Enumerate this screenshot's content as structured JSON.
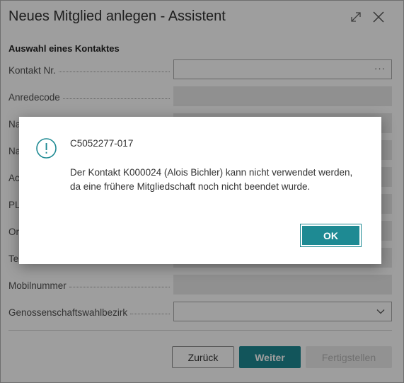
{
  "window": {
    "title": "Neues Mitglied anlegen - Assistent",
    "expand_icon": "expand-icon",
    "close_icon": "close-icon"
  },
  "section": {
    "heading": "Auswahl eines Kontaktes"
  },
  "fields": [
    {
      "label": "Kontakt Nr.",
      "value": "",
      "lookup": "···"
    },
    {
      "label": "Anredecode",
      "value": ""
    },
    {
      "label": "Na",
      "value": ""
    },
    {
      "label": "Na",
      "value": ""
    },
    {
      "label": "Ac",
      "value": ""
    },
    {
      "label": "PL",
      "value": ""
    },
    {
      "label": "Or",
      "value": ""
    },
    {
      "label": "Te",
      "value": ""
    },
    {
      "label": "Mobilnummer",
      "value": ""
    },
    {
      "label": "Genossenschaftswahlbezirk",
      "value": ""
    }
  ],
  "buttons": {
    "back": "Zurück",
    "next": "Weiter",
    "finish": "Fertigstellen"
  },
  "dialog": {
    "icon": "warning-info-icon",
    "code": "C5052277-017",
    "message": "Der Kontakt K000024 (Alois Bichler) kann nicht verwendet werden, da eine frühere Mitgliedschaft noch nicht beendet wurde.",
    "ok_label": "OK"
  },
  "colors": {
    "accent": "#1e8a93",
    "overlay": "rgba(0,0,0,0.38)"
  }
}
